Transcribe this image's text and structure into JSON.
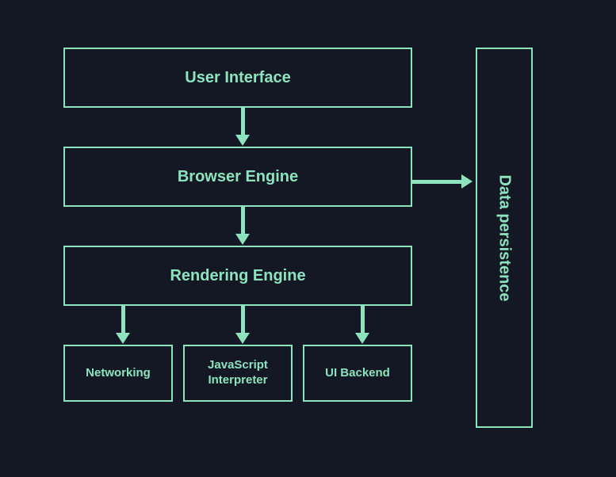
{
  "boxes": {
    "ui": {
      "label": "User Interface"
    },
    "browser": {
      "label": "Browser Engine"
    },
    "rendering": {
      "label": "Rendering Engine"
    },
    "networking": {
      "label": "Networking"
    },
    "js": {
      "label": "JavaScript\nInterpreter"
    },
    "backend": {
      "label": "UI Backend"
    },
    "persist": {
      "label": "Data persistence"
    }
  },
  "flows": [
    {
      "from": "ui",
      "to": "browser",
      "dir": "down"
    },
    {
      "from": "browser",
      "to": "rendering",
      "dir": "down"
    },
    {
      "from": "rendering",
      "to": "networking",
      "dir": "down"
    },
    {
      "from": "rendering",
      "to": "js",
      "dir": "down"
    },
    {
      "from": "rendering",
      "to": "backend",
      "dir": "down"
    },
    {
      "from": "browser",
      "to": "persist",
      "dir": "right"
    }
  ],
  "colors": {
    "background": "#141824",
    "stroke": "#8de3bd",
    "text": "#8de3bd"
  }
}
